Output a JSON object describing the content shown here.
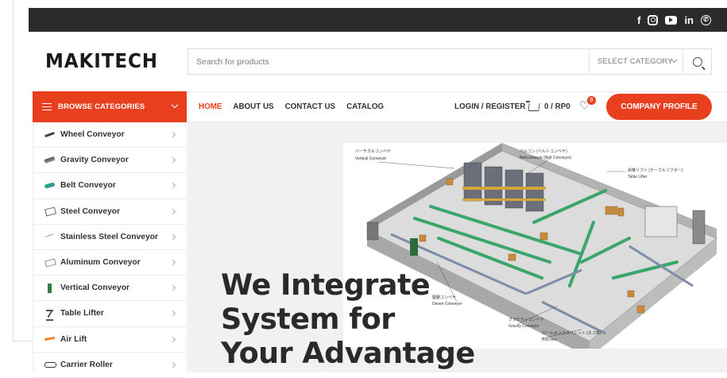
{
  "social": {
    "icons": [
      "facebook-icon",
      "instagram-icon",
      "youtube-icon",
      "linkedin-icon",
      "whatsapp-icon"
    ]
  },
  "header": {
    "logo": "MAKITECH",
    "search_placeholder": "Search for products",
    "select_category": "SELECT CATEGORY"
  },
  "nav": {
    "browse": "BROWSE CATEGORIES",
    "items": [
      {
        "label": "HOME",
        "active": true
      },
      {
        "label": "ABOUT US",
        "active": false
      },
      {
        "label": "CONTACT US",
        "active": false
      },
      {
        "label": "CATALOG",
        "active": false
      }
    ],
    "login": "LOGIN / REGISTER",
    "cart": "0 / RP0",
    "wishlist_count": "0",
    "profile_button": "COMPANY PROFILE"
  },
  "categories": [
    {
      "label": "Wheel Conveyor",
      "icon": "wheel-conveyor-icon"
    },
    {
      "label": "Gravity Conveyor",
      "icon": "gravity-conveyor-icon"
    },
    {
      "label": "Belt Conveyor",
      "icon": "belt-conveyor-icon"
    },
    {
      "label": "Steel Conveyor",
      "icon": "steel-conveyor-icon"
    },
    {
      "label": "Stainless Steel Conveyor",
      "icon": "stainless-conveyor-icon"
    },
    {
      "label": "Aluminum Conveyor",
      "icon": "aluminum-conveyor-icon"
    },
    {
      "label": "Vertical Conveyor",
      "icon": "vertical-conveyor-icon"
    },
    {
      "label": "Table Lifter",
      "icon": "table-lifter-icon"
    },
    {
      "label": "Air Lift",
      "icon": "air-lift-icon"
    },
    {
      "label": "Carrier Roller",
      "icon": "carrier-roller-icon"
    }
  ],
  "hero": {
    "title_lines": [
      "We Integrate",
      "System for",
      "Your Advantage"
    ],
    "diagram_labels": {
      "vertical_jp": "バーチカルコンベヤ",
      "vertical_en": "Vertical Conveyor",
      "belt_jp": "ベルコン (ベルトコンベヤ)",
      "belt_en": "Beltconveyor (Belt Conveyor)",
      "table_jp": "昇降リフト (テーブルリフター)",
      "table_en": "Table Lifter",
      "driven_jp": "駆動コンベヤ",
      "driven_en": "Driven Conveyor",
      "gravity_jp": "グラビティコンベヤ",
      "gravity_en": "Gravity Conveyor",
      "roll_jp": "ロールボックスパレット (カゴ車)",
      "roll_en": "Roll box"
    }
  }
}
